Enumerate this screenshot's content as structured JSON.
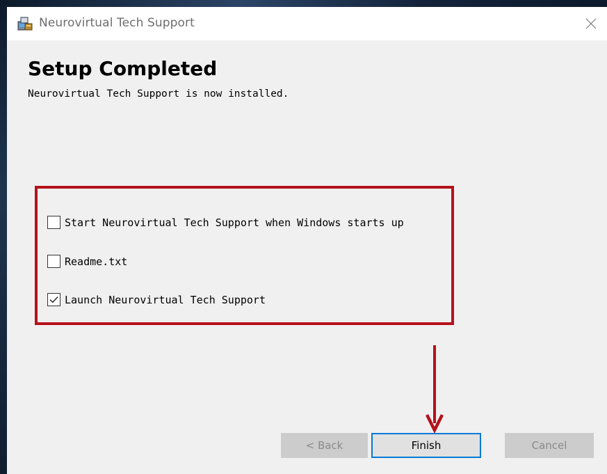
{
  "window": {
    "title": "Neurovirtual Tech Support",
    "close_icon": "close-icon",
    "app_icon": "installer-icon"
  },
  "page": {
    "heading": "Setup Completed",
    "subheading": "Neurovirtual Tech Support is now installed."
  },
  "options": [
    {
      "label": "Start Neurovirtual Tech Support when Windows starts up",
      "checked": false
    },
    {
      "label": "Readme.txt",
      "checked": false
    },
    {
      "label": "Launch Neurovirtual Tech Support",
      "checked": true
    }
  ],
  "buttons": {
    "back": "< Back",
    "finish": "Finish",
    "cancel": "Cancel"
  },
  "colors": {
    "highlight": "#b5121b",
    "focus_border": "#0078d7"
  },
  "annotations": {
    "frame_icon": "highlight-frame",
    "arrow_icon": "down-arrow-icon"
  }
}
